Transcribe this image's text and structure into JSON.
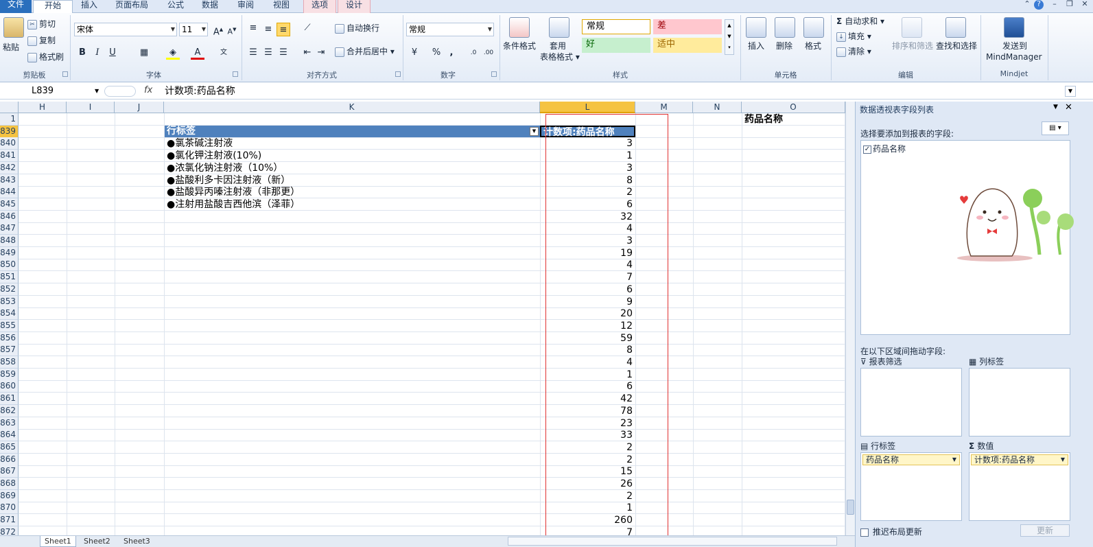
{
  "tabs": [
    "文件",
    "开始",
    "插入",
    "页面布局",
    "公式",
    "数据",
    "审阅",
    "视图",
    "选项",
    "设计"
  ],
  "clipboard": {
    "paste": "粘贴",
    "cut": "剪切",
    "copy": "复制",
    "format_painter": "格式刷",
    "group": "剪贴板"
  },
  "font": {
    "name": "宋体",
    "size": "11",
    "bold": "B",
    "italic": "I",
    "underline": "U",
    "grow": "A",
    "shrink": "A",
    "group": "字体"
  },
  "alignment": {
    "wrap": "自动换行",
    "merge": "合并后居中",
    "group": "对齐方式"
  },
  "number": {
    "format": "常规",
    "percent": "%",
    "comma": ",",
    "group": "数字"
  },
  "styles": {
    "conditional": "条件格式",
    "table_format_1": "套用",
    "table_format_2": "表格格式",
    "normal": "常规",
    "bad": "差",
    "good": "好",
    "neutral": "适中",
    "group": "样式"
  },
  "cells": {
    "insert": "插入",
    "delete": "删除",
    "format": "格式",
    "group": "单元格"
  },
  "editing": {
    "autosum": "自动求和",
    "fill": "填充",
    "clear": "清除",
    "sort": "排序和筛选",
    "find": "查找和选择",
    "group": "编辑"
  },
  "mindjet": {
    "send_1": "发送到",
    "send_2": "MindManager",
    "group": "Mindjet"
  },
  "formula_bar": {
    "name_box": "L839",
    "fx": "fx",
    "content": "计数项:药品名称"
  },
  "columns": [
    "H",
    "I",
    "J",
    "K",
    "L",
    "M",
    "N",
    "O"
  ],
  "rows": [
    "1",
    "839",
    "840",
    "841",
    "842",
    "843",
    "844",
    "845",
    "846",
    "847",
    "848",
    "849",
    "850",
    "851",
    "852",
    "853",
    "854",
    "855",
    "856",
    "857",
    "858",
    "859",
    "860",
    "861",
    "862",
    "863",
    "864",
    "865",
    "866",
    "867",
    "868",
    "869",
    "870",
    "871",
    "872"
  ],
  "cells_o1": "药品名称",
  "pivot": {
    "row_label_header": "行标签",
    "value_header": "计数项:药品名称",
    "items": [
      "●氯茶碱注射液",
      "●氯化钾注射液(10%)",
      "●浓氯化钠注射液（10%）",
      "●盐酸利多卡因注射液（新）",
      "●盐酸异丙嗪注射液（非那更）",
      "●注射用盐酸吉西他滨（泽菲）"
    ],
    "values": [
      "3",
      "1",
      "3",
      "8",
      "2",
      "6",
      "32",
      "4",
      "3",
      "19",
      "4",
      "7",
      "6",
      "9",
      "20",
      "12",
      "59",
      "8",
      "4",
      "1",
      "6",
      "42",
      "78",
      "23",
      "33",
      "2",
      "2",
      "15",
      "26",
      "2",
      "1",
      "260",
      "7"
    ]
  },
  "sheet_tabs": [
    "Sheet1",
    "Sheet2",
    "Sheet3"
  ],
  "pane": {
    "title": "数据透视表字段列表",
    "choose_fields": "选择要添加到报表的字段:",
    "field": "药品名称",
    "drag_between": "在以下区域间拖动字段:",
    "report_filter": "报表筛选",
    "column_labels": "列标签",
    "row_labels": "行标签",
    "values": "数值",
    "row_field": "药品名称",
    "value_field": "计数项:药品名称",
    "defer": "推迟布局更新",
    "update": "更新"
  },
  "colors": {
    "pivot_header": "#4f81bd",
    "bad": "#ffc7ce",
    "good": "#c6efce",
    "neutral": "#ffeb9c",
    "selected_col": "#f5c342",
    "red_box": "#e03030"
  }
}
